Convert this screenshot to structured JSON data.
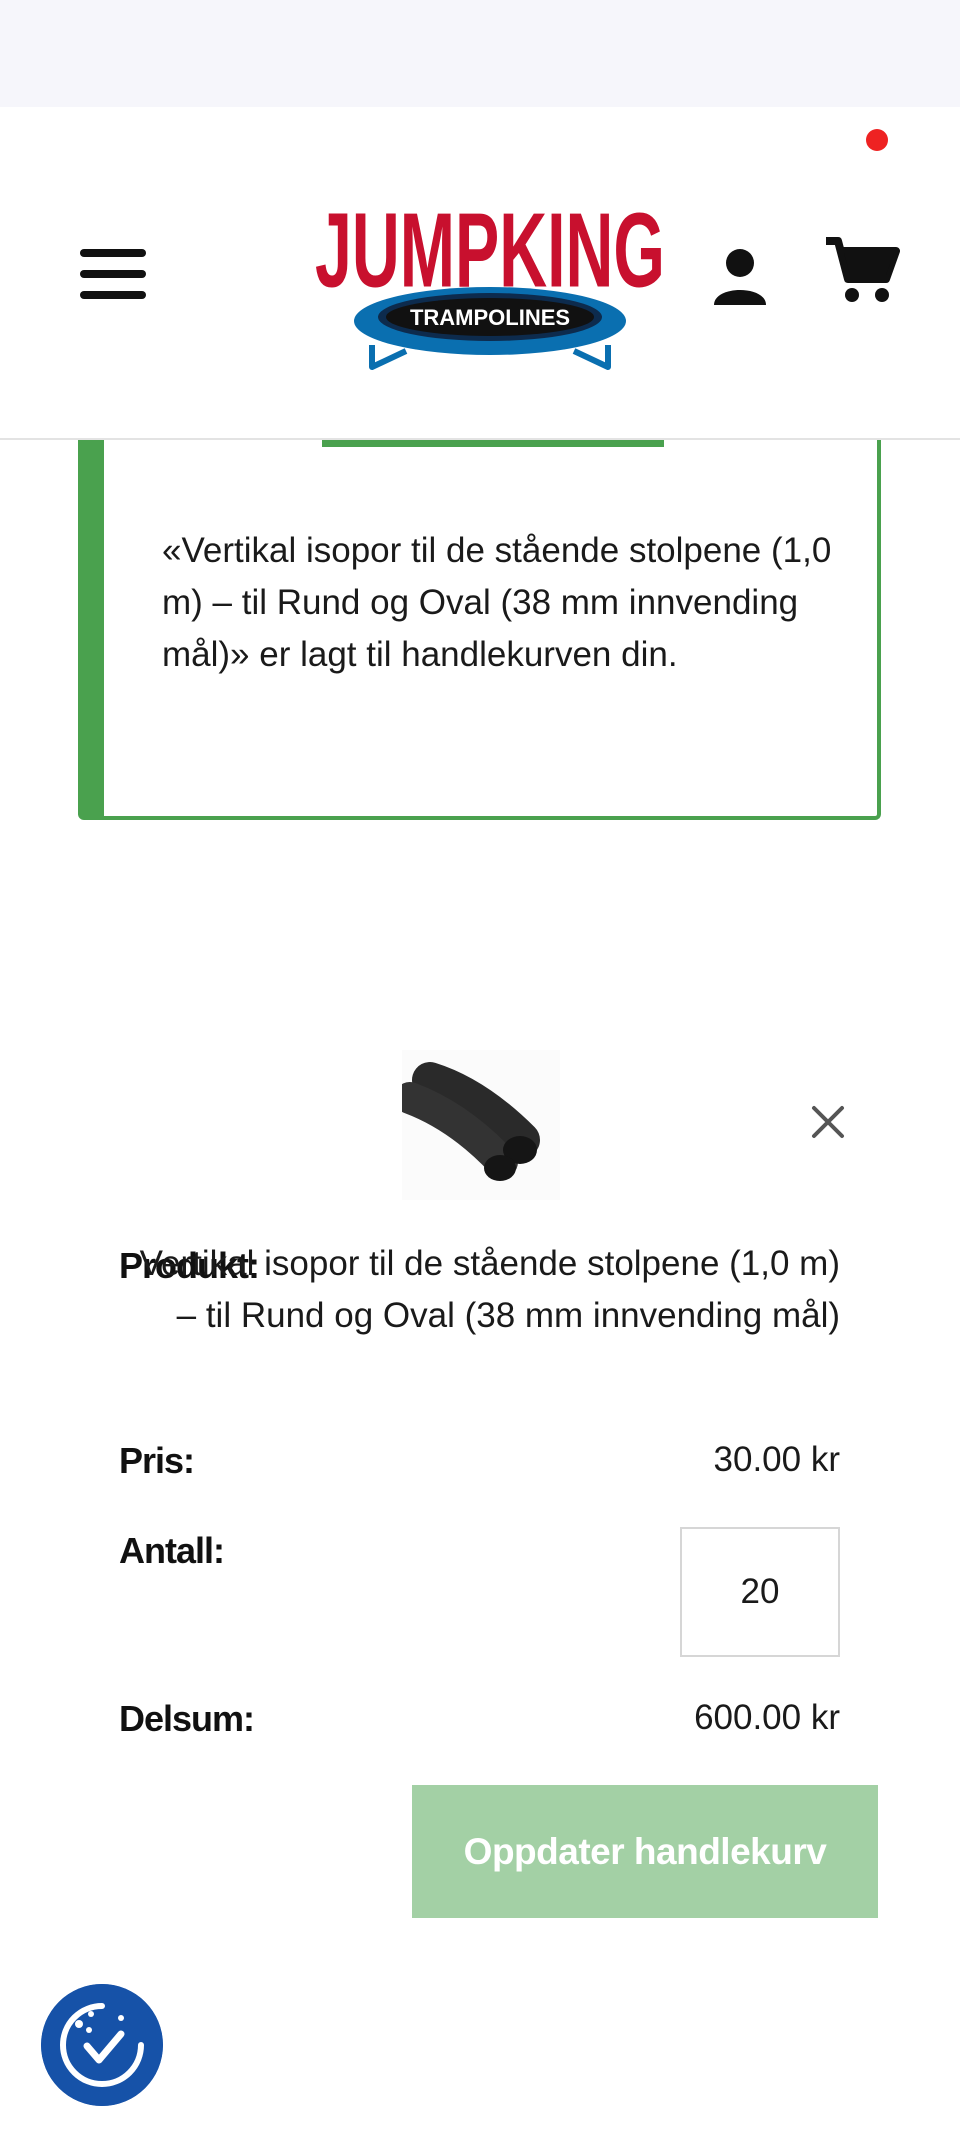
{
  "header": {
    "logo_main": "JUMPKING",
    "logo_sub": "TRAMPOLINES",
    "menu_icon": "hamburger-menu-icon",
    "account_icon": "user-icon",
    "cart_icon": "shopping-cart-icon",
    "cart_dot_color": "#ee2222"
  },
  "notice": {
    "message": "«Vertikal isopor til de stående stolpene (1,0 m) – til Rund og Oval (38 mm innvending mål)» er lagt til handlekurven din.",
    "accent_color": "#4aa14e"
  },
  "cart_item": {
    "image_alt": "Vertikal isopor",
    "remove_icon": "close-icon",
    "product_label": "Produkt:",
    "product_name": "Vertikal isopor til de stående stolpene (1,0 m) – til Rund og Oval (38 mm innvending mål)",
    "price_label": "Pris:",
    "price_value": "30.00 kr",
    "quantity_label": "Antall:",
    "quantity_value": "20",
    "subtotal_label": "Delsum:",
    "subtotal_value": "600.00 kr"
  },
  "actions": {
    "update_cart_label": "Oppdater handlekurv",
    "update_cart_color": "#a3d0a5"
  },
  "cookie": {
    "icon": "cookie-consent-icon",
    "color": "#1652a8"
  }
}
